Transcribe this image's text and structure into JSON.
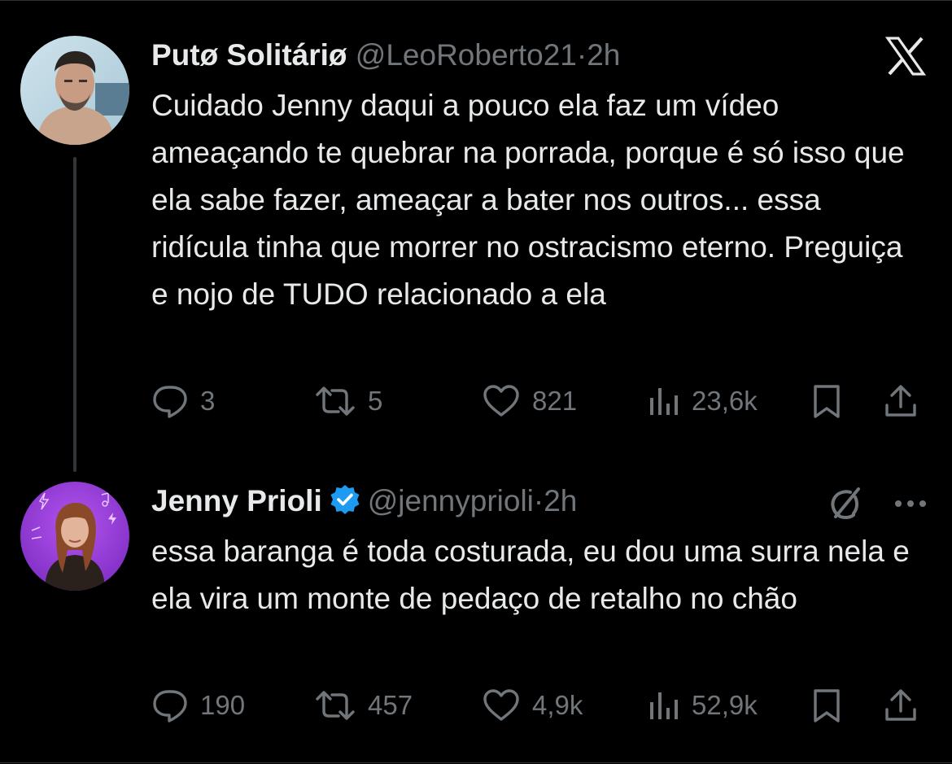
{
  "tweets": [
    {
      "name": "Putø Solitáriø",
      "handle": "@LeoRoberto21",
      "separator": "·",
      "time": "2h",
      "text": "Cuidado Jenny daqui a pouco ela faz um vídeo ameaçando te quebrar na porrada, porque é só isso que ela sabe fazer, ameaçar a bater nos outros... essa ridícula tinha que morrer no ostracismo eterno. Preguiça e nojo de TUDO relacionado a ela",
      "replies": "3",
      "retweets": "5",
      "likes": "821",
      "views": "23,6k",
      "avatar_icon": "profile-photo-man"
    },
    {
      "name": "Jenny Prioli",
      "handle": "@jennyprioli",
      "separator": "·",
      "time": "2h",
      "verified": true,
      "text": "essa baranga é toda costurada, eu dou uma surra nela e ela vira um monte de pedaço de retalho no chão",
      "replies": "190",
      "retweets": "457",
      "likes": "4,9k",
      "views": "52,9k",
      "avatar_icon": "profile-photo-woman-purple-background"
    }
  ],
  "icons": {
    "top_right_logo": "x-logo-icon",
    "grok": "grok-icon",
    "more": "more-options-icon",
    "reply": "reply-icon",
    "retweet": "retweet-icon",
    "like": "heart-icon",
    "views": "views-chart-icon",
    "bookmark": "bookmark-icon",
    "share": "share-icon"
  },
  "colors": {
    "background": "#000000",
    "text_primary": "#e7e9ea",
    "text_secondary": "#71767b",
    "verified_blue": "#1d9bf0",
    "thread_line": "#333639"
  }
}
